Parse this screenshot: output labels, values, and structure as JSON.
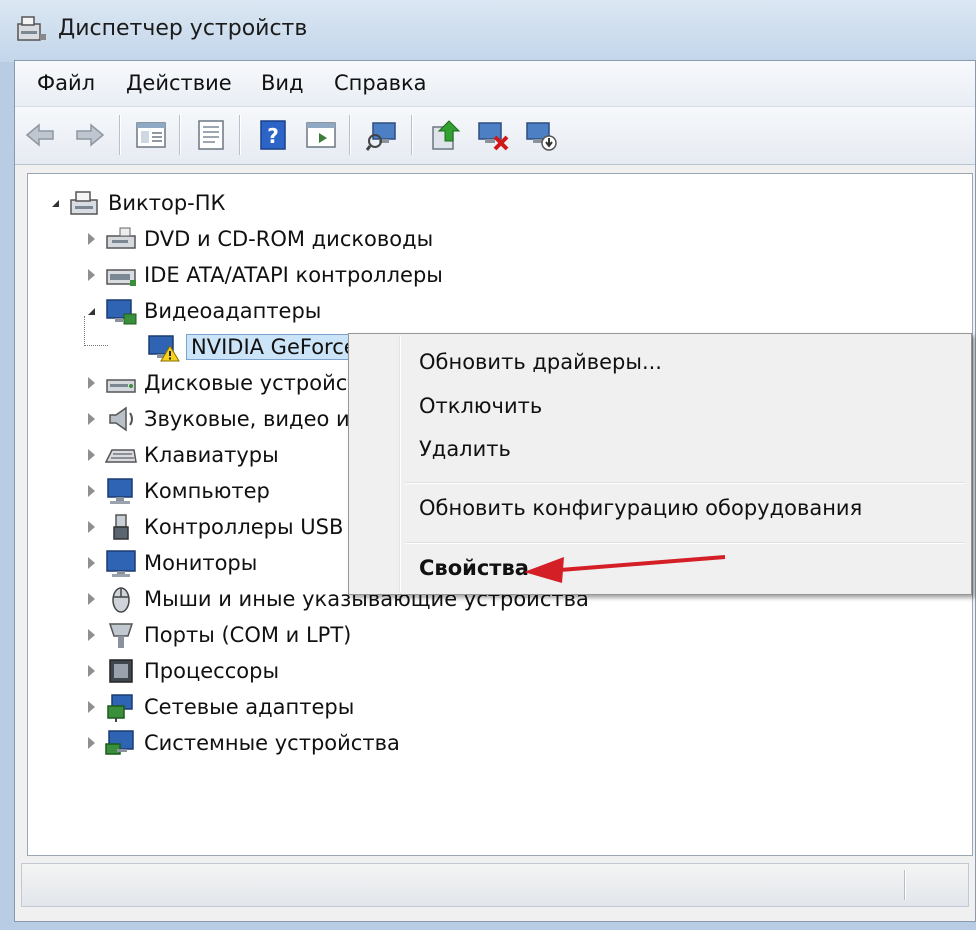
{
  "window": {
    "title": "Диспетчер устройств"
  },
  "menu": {
    "items": [
      "Файл",
      "Действие",
      "Вид",
      "Справка"
    ]
  },
  "toolbar": {
    "buttons": [
      "back-icon",
      "forward-icon",
      "show-hide-tree-icon",
      "properties-icon",
      "help-icon",
      "action-pane-icon",
      "scan-hardware-icon",
      "update-driver-icon",
      "uninstall-icon",
      "disable-icon"
    ]
  },
  "tree": {
    "root": "Виктор-ПК",
    "categories": [
      {
        "label": "DVD и CD-ROM дисководы",
        "icon": "dvd-drive-icon",
        "expanded": false
      },
      {
        "label": "IDE ATA/ATAPI контроллеры",
        "icon": "ide-controller-icon",
        "expanded": false
      },
      {
        "label": "Видеоадаптеры",
        "icon": "display-adapter-icon",
        "expanded": true
      },
      {
        "label": "NVIDIA GeForce",
        "icon": "warning-display-icon",
        "child": true,
        "selected": true
      },
      {
        "label": "Дисковые устройства",
        "icon": "disk-drive-icon",
        "expanded": false
      },
      {
        "label": "Звуковые, видео и игровые устройства",
        "icon": "speaker-icon",
        "expanded": false
      },
      {
        "label": "Клавиатуры",
        "icon": "keyboard-icon",
        "expanded": false
      },
      {
        "label": "Компьютер",
        "icon": "computer-icon",
        "expanded": false
      },
      {
        "label": "Контроллеры USB",
        "icon": "usb-icon",
        "expanded": false
      },
      {
        "label": "Мониторы",
        "icon": "monitor-icon",
        "expanded": false
      },
      {
        "label": "Мыши и иные указывающие устройства",
        "icon": "mouse-icon",
        "expanded": false
      },
      {
        "label": "Порты (COM и LPT)",
        "icon": "port-icon",
        "expanded": false
      },
      {
        "label": "Процессоры",
        "icon": "processor-icon",
        "expanded": false
      },
      {
        "label": "Сетевые адаптеры",
        "icon": "network-adapter-icon",
        "expanded": false
      },
      {
        "label": "Системные устройства",
        "icon": "system-device-icon",
        "expanded": false
      }
    ]
  },
  "context_menu": {
    "items": [
      "Обновить драйверы...",
      "Отключить",
      "Удалить",
      "Обновить конфигурацию оборудования",
      "Свойства"
    ]
  },
  "colors": {
    "arrow": "#d41f26",
    "selection": "#cce4f7"
  }
}
